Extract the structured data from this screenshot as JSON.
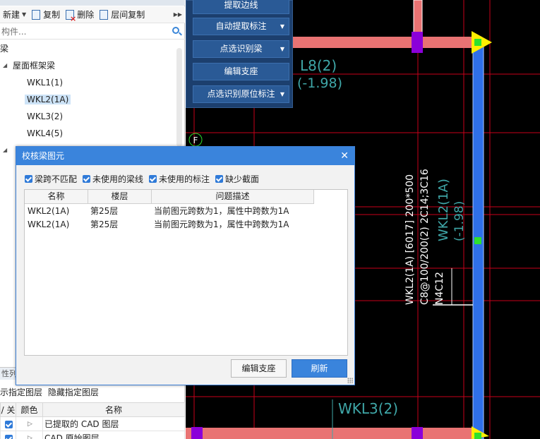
{
  "left_panel": {
    "toolbar": {
      "new_label": "新建",
      "copy_label": "复制",
      "delete_label": "删除",
      "floor_copy_label": "层间复制"
    },
    "search": {
      "placeholder": "构件..."
    },
    "tree": {
      "root_label": "梁",
      "group_label": "屋面框架梁",
      "items": [
        "WKL1(1)",
        "WKL2(1A)",
        "WKL3(2)",
        "WKL4(5)"
      ],
      "selected_item": "WKL2(1A)"
    },
    "lower_section_label": "性列表",
    "layer_links": {
      "show_label": "示指定图层",
      "hide_label": "隐藏指定图层"
    },
    "layer_table": {
      "headers": [
        "/ 关",
        "颜色",
        "名称"
      ],
      "rows": [
        {
          "name": "已提取的 CAD 图层"
        },
        {
          "name": "CAD 原始图层"
        }
      ]
    }
  },
  "tool_panel": {
    "buttons": [
      {
        "label": "提取边线",
        "has_menu": false
      },
      {
        "label": "自动提取标注",
        "has_menu": true
      },
      {
        "label": "点选识别梁",
        "has_menu": true
      },
      {
        "label": "编辑支座",
        "has_menu": false
      },
      {
        "label": "点选识别原位标注",
        "has_menu": true
      }
    ]
  },
  "cad": {
    "labels": {
      "beam_l8": "L8(2)",
      "beam_l8_offset": "(-1.98)",
      "axis_f": "F",
      "wkl2_annot_1": "WKL2(1A) [6017] 200*500",
      "wkl2_annot_2": "C8@100/200(2) 2C14;3C16",
      "wkl2_annot_3": "N4C12",
      "wkl2_beam_label": "WKL2(1A)",
      "wkl2_beam_offset": "(-1.98)",
      "wkl3_label": "WKL3(2)"
    },
    "colors": {
      "background": "#000000",
      "axis_line": "#c8001a",
      "beam_fill": "#e97373",
      "selected_beam": "#2f6fe8",
      "support_marker": "#8b00d9",
      "endpoint_marker": "#ffee00",
      "cyan_text": "#3fa7a8"
    }
  },
  "dialog": {
    "title": "校核梁图元",
    "filters": [
      {
        "label": "梁跨不匹配",
        "checked": true
      },
      {
        "label": "未使用的梁线",
        "checked": true
      },
      {
        "label": "未使用的标注",
        "checked": true
      },
      {
        "label": "缺少截面",
        "checked": true
      }
    ],
    "table": {
      "headers": [
        "名称",
        "楼层",
        "问题描述"
      ],
      "rows": [
        {
          "name": "WKL2(1A)",
          "floor": "第25层",
          "desc": "当前图元跨数为1，属性中跨数为1A"
        },
        {
          "name": "WKL2(1A)",
          "floor": "第25层",
          "desc": "当前图元跨数为1，属性中跨数为1A"
        }
      ]
    },
    "buttons": {
      "edit_support": "编辑支座",
      "refresh": "刷新"
    }
  }
}
